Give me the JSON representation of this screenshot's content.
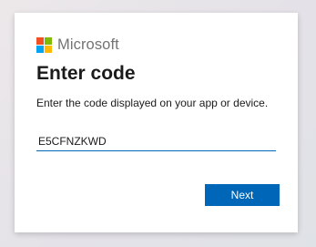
{
  "brand": {
    "name": "Microsoft",
    "logo_icon": "microsoft-four-squares-logo",
    "colors": {
      "red": "#f25022",
      "green": "#7fba00",
      "blue": "#00a4ef",
      "yellow": "#ffb900",
      "accent": "#0067b8"
    }
  },
  "page": {
    "title": "Enter code",
    "description": "Enter the code displayed on your app or device."
  },
  "form": {
    "code_value": "E5CFNZKWD",
    "next_label": "Next"
  }
}
